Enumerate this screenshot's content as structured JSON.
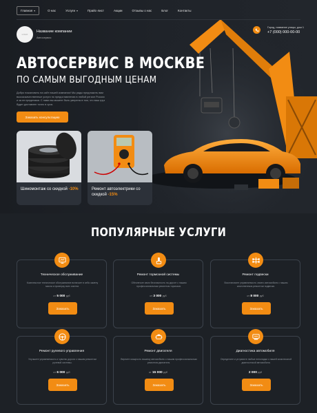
{
  "nav": {
    "items": [
      {
        "label": "Главная",
        "caret": true,
        "active": true
      },
      {
        "label": "О нас",
        "caret": false
      },
      {
        "label": "Услуги",
        "caret": true
      },
      {
        "label": "Прайс-лист",
        "caret": false
      },
      {
        "label": "Акции",
        "caret": false
      },
      {
        "label": "Отзывы о нас",
        "caret": false
      },
      {
        "label": "Блог",
        "caret": false
      },
      {
        "label": "Контакты",
        "caret": false
      }
    ]
  },
  "company": {
    "logo_text": "LOGO",
    "name": "Название компании",
    "subtitle": "Автосервис"
  },
  "contacts": {
    "address": "Город, название улицы, дом 1",
    "phone": "+7 (000) 000-00-00"
  },
  "hero": {
    "title": "АВТОСЕРВИС В МОСКВЕ",
    "subtitle": "ПО САМЫМ ВЫГОДНЫМ ЦЕНАМ",
    "intro": "Добро пожаловать на сайт нашей компании! Мы рады предложить вам высококачественные услуги по предоставлению в любой регион России и за ее пределами. С нами вы можете быть уверены в том, что ваш груз будет доставлен точно в срок.",
    "cta": "Заказать консультацию"
  },
  "promos": [
    {
      "title": "Шиномонтаж со скидкой",
      "discount": "-10%"
    },
    {
      "title": "Ремонт автоэлектрики со скидкой",
      "discount": "-15%"
    }
  ],
  "services": {
    "title": "ПОПУЛЯРНЫЕ УСЛУГИ",
    "items": [
      {
        "title": "Техническое обслуживание",
        "desc": "Комплексное техническое обслуживание включает в себя замену масла и проверку всех систем.",
        "prefix": "от",
        "price": "5 000",
        "currency": "руб",
        "button": "Заказать",
        "icon": "computer-diagnostic-icon"
      },
      {
        "title": "Ремонт тормозной системы",
        "desc": "Обеспечьте свою безопасность на дороге с нашим профессиональным ремонтом тормозов.",
        "prefix": "от",
        "price": "3 000",
        "currency": "руб",
        "button": "Заказать",
        "icon": "brake-handle-icon"
      },
      {
        "title": "Ремонт подвески",
        "desc": "Восстановите управляемость своего автомобиля с нашим качественным ремонтом подвески.",
        "prefix": "от",
        "price": "8 000",
        "currency": "руб",
        "button": "Заказать",
        "icon": "chassis-suspension-icon"
      },
      {
        "title": "Ремонт рулевого управления",
        "desc": "Улучшите управляемость и чувство дороги с нашим ремонтом рулевой системы.",
        "prefix": "от",
        "price": "6 000",
        "currency": "руб",
        "button": "Заказать",
        "icon": "steering-wheel-icon"
      },
      {
        "title": "Ремонт двигателя",
        "desc": "Верните мощность вашему автомобилю с нашим профессиональным ремонтом двигателя.",
        "prefix": "от",
        "price": "15 000",
        "currency": "руб",
        "button": "Заказать",
        "icon": "engine-icon"
      },
      {
        "title": "Диагностика автомобиля",
        "desc": "Определите и устраните любые неполадки с нашей комплексной диагностикой автомобиля.",
        "prefix": "",
        "price": "2 000",
        "currency": "руб",
        "button": "Заказать",
        "icon": "car-diagnostics-icon"
      }
    ]
  },
  "colors": {
    "accent": "#f28c13",
    "background": "#1d2126"
  }
}
